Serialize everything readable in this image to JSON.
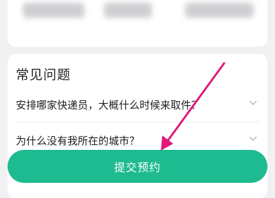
{
  "faq": {
    "title": "常见问题",
    "items": [
      {
        "question": "安排哪家快递员，大概什么时候来取件？"
      },
      {
        "question": "为什么没有我所在的城市？"
      }
    ]
  },
  "actions": {
    "submit_label": "提交预约"
  },
  "colors": {
    "primary": "#1dbb8f",
    "annotation_arrow": "#e0187a",
    "page_background": "#f1f1f3"
  }
}
